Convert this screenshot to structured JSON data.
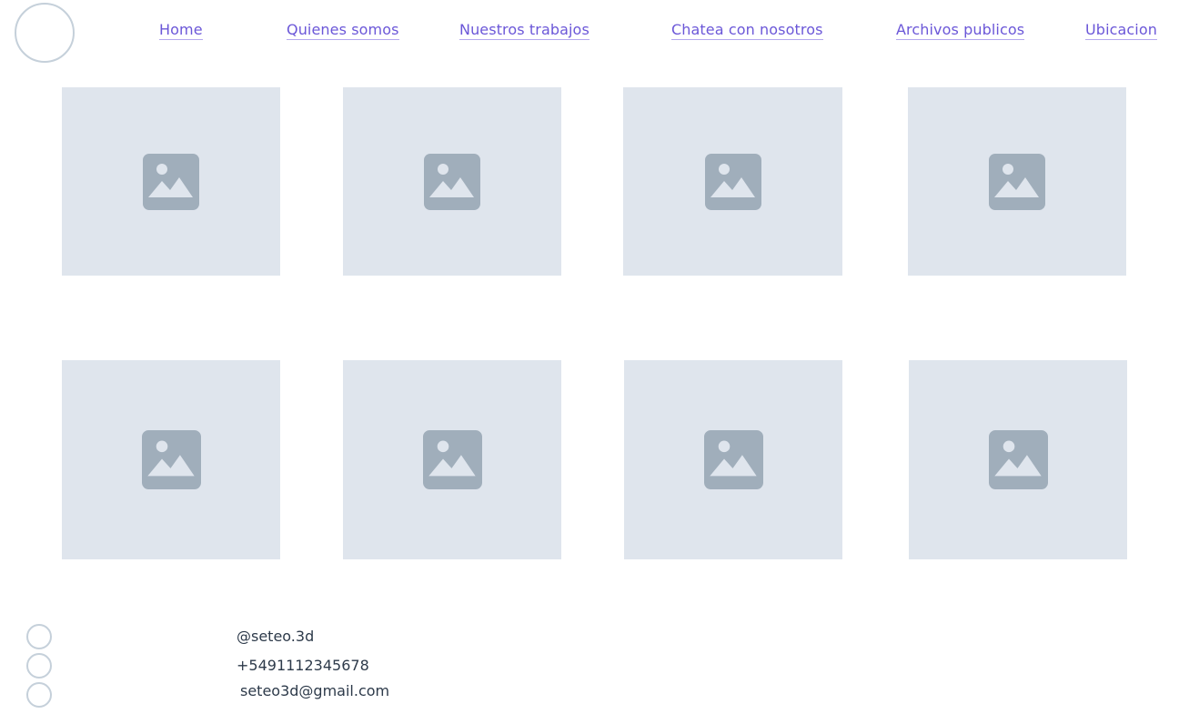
{
  "header": {
    "logo": "logo-placeholder",
    "nav": [
      {
        "label": "Home"
      },
      {
        "label": "Quienes somos"
      },
      {
        "label": "Nuestros trabajos"
      },
      {
        "label": "Chatea con nosotros"
      },
      {
        "label": "Archivos publicos"
      },
      {
        "label": "Ubicacion"
      }
    ]
  },
  "gallery": {
    "items": [
      {
        "icon": "image-placeholder-icon"
      },
      {
        "icon": "image-placeholder-icon"
      },
      {
        "icon": "image-placeholder-icon"
      },
      {
        "icon": "image-placeholder-icon"
      },
      {
        "icon": "image-placeholder-icon"
      },
      {
        "icon": "image-placeholder-icon"
      },
      {
        "icon": "image-placeholder-icon"
      },
      {
        "icon": "image-placeholder-icon"
      }
    ]
  },
  "footer": {
    "contacts": [
      {
        "icon": "circle-icon",
        "text": "@seteo.3d"
      },
      {
        "icon": "circle-icon",
        "text": "+5491112345678"
      },
      {
        "icon": "circle-icon",
        "text": "seteo3d@gmail.com"
      }
    ]
  },
  "colors": {
    "link": "#6b57d8",
    "tile_bg": "#dfe5ed",
    "icon": "#a0aebb",
    "outline": "#c5d0da",
    "text": "#2d3a4a"
  }
}
